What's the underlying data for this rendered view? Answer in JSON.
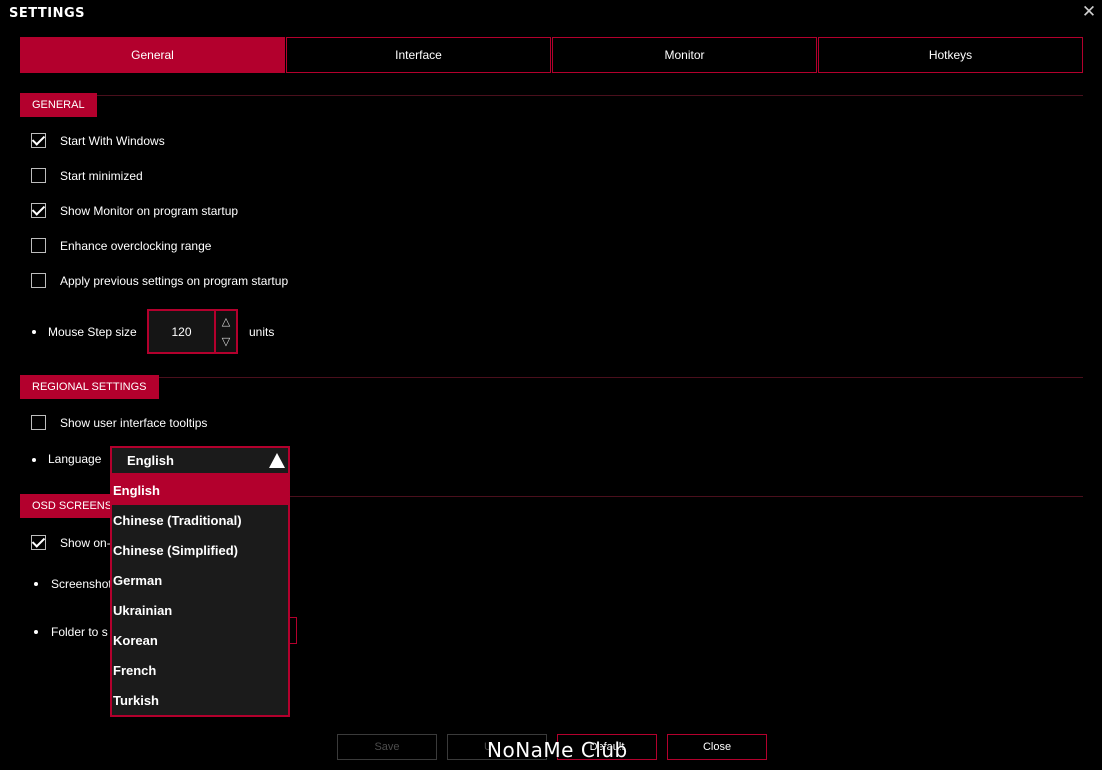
{
  "window": {
    "title": "SETTINGS",
    "close_icon": "close-icon"
  },
  "tabs": [
    {
      "label": "General",
      "active": true
    },
    {
      "label": "Interface",
      "active": false
    },
    {
      "label": "Monitor",
      "active": false
    },
    {
      "label": "Hotkeys",
      "active": false
    }
  ],
  "general": {
    "section_label": "GENERAL",
    "options": [
      {
        "label": "Start With Windows",
        "checked": true
      },
      {
        "label": "Start minimized",
        "checked": false
      },
      {
        "label": "Show Monitor on program startup",
        "checked": true
      },
      {
        "label": "Enhance overclocking range",
        "checked": false
      },
      {
        "label": "Apply previous settings on program startup",
        "checked": false
      }
    ],
    "mouse_step": {
      "label": "Mouse Step size",
      "value": "120",
      "unit": "units"
    }
  },
  "regional": {
    "section_label": "REGIONAL SETTINGS",
    "tooltips": {
      "label": "Show user interface tooltips",
      "checked": false
    },
    "language": {
      "label": "Language",
      "selected": "English",
      "options": [
        "English",
        "Chinese (Traditional)",
        "Chinese (Simplified)",
        "German",
        "Ukrainian",
        "Korean",
        "French",
        "Turkish"
      ]
    }
  },
  "osd": {
    "section_label_visible": "OSD SCREENSH",
    "show_on_label_visible": "Show on-",
    "show_on_checked": true,
    "screenshot_label_visible": "Screenshot",
    "folder_label_visible": "Folder to s"
  },
  "buttons": {
    "save": "Save",
    "apply_partial": "U",
    "default": "Default",
    "close": "Close"
  },
  "watermark": "NoNaMe Club",
  "colors": {
    "accent": "#b3002d",
    "background": "#000000",
    "dropdown_bg": "#1b1b1b"
  }
}
